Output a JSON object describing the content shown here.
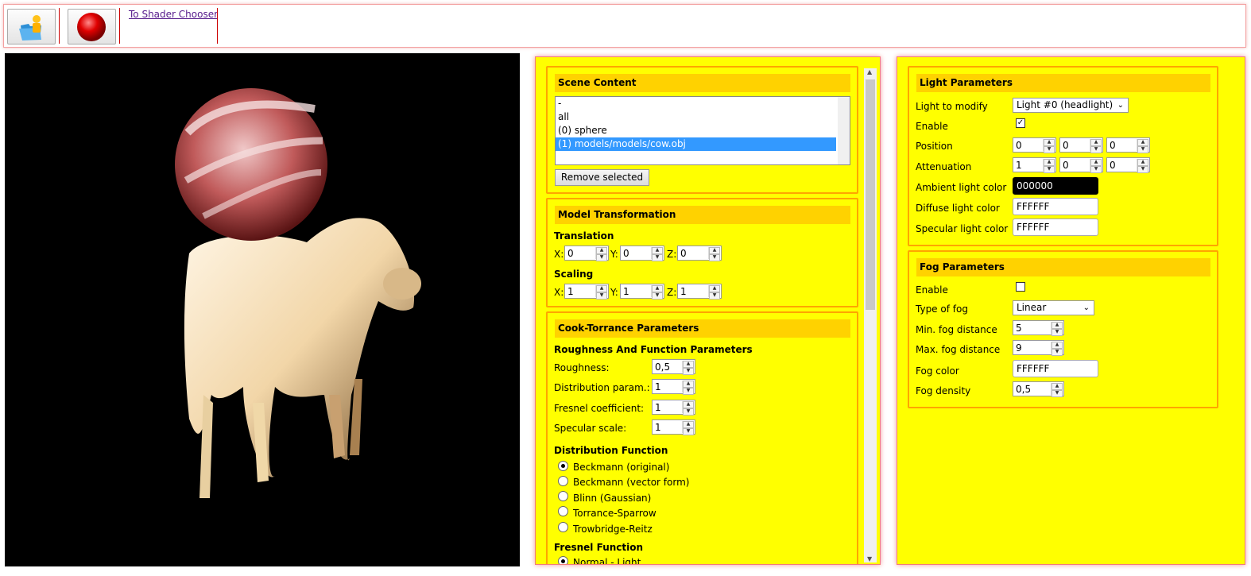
{
  "toolbar": {
    "link_label": "To Shader Chooser"
  },
  "scene": {
    "title": "Scene Content",
    "items": [
      "-",
      "all",
      "(0) sphere",
      "(1) models/models/cow.obj"
    ],
    "remove_label": "Remove selected"
  },
  "model": {
    "title": "Model Transformation",
    "translation_label": "Translation",
    "scaling_label": "Scaling",
    "x_label": "X:",
    "y_label": "Y:",
    "z_label": "Z:",
    "translation": {
      "x": "0",
      "y": "0",
      "z": "0"
    },
    "scaling": {
      "x": "1",
      "y": "1",
      "z": "1"
    }
  },
  "cook": {
    "title": "Cook-Torrance Parameters",
    "sub_label": "Roughness And Function Parameters",
    "roughness_label": "Roughness:",
    "roughness": "0,5",
    "distribution_param_label": "Distribution param.:",
    "distribution_param": "1",
    "fresnel_coeff_label": "Fresnel coefficient:",
    "fresnel_coeff": "1",
    "specular_scale_label": "Specular scale:",
    "specular_scale": "1",
    "distribution_label": "Distribution Function",
    "distributions": [
      "Beckmann (original)",
      "Beckmann (vector form)",
      "Blinn (Gaussian)",
      "Torrance-Sparrow",
      "Trowbridge-Reitz"
    ],
    "fresnel_label": "Fresnel Function",
    "fresnel_first": "Normal - Light"
  },
  "light": {
    "title": "Light Parameters",
    "modify_label": "Light to modify",
    "modify_value": "Light #0 (headlight)",
    "enable_label": "Enable",
    "position_label": "Position",
    "position": [
      "0",
      "0",
      "0"
    ],
    "attenuation_label": "Attenuation",
    "attenuation": [
      "1",
      "0",
      "0"
    ],
    "ambient_label": "Ambient light color",
    "ambient": "000000",
    "diffuse_label": "Diffuse light color",
    "diffuse": "FFFFFF",
    "specular_label": "Specular light color",
    "specular": "FFFFFF"
  },
  "fog": {
    "title": "Fog Parameters",
    "enable_label": "Enable",
    "type_label": "Type of fog",
    "type_value": "Linear",
    "min_label": "Min. fog distance",
    "min": "5",
    "max_label": "Max. fog distance",
    "max": "9",
    "color_label": "Fog color",
    "color": "FFFFFF",
    "density_label": "Fog density",
    "density": "0,5"
  },
  "colors": {
    "panel_bg": "#ffff00",
    "section_head": "#ffd200",
    "selection": "#3399ff"
  }
}
